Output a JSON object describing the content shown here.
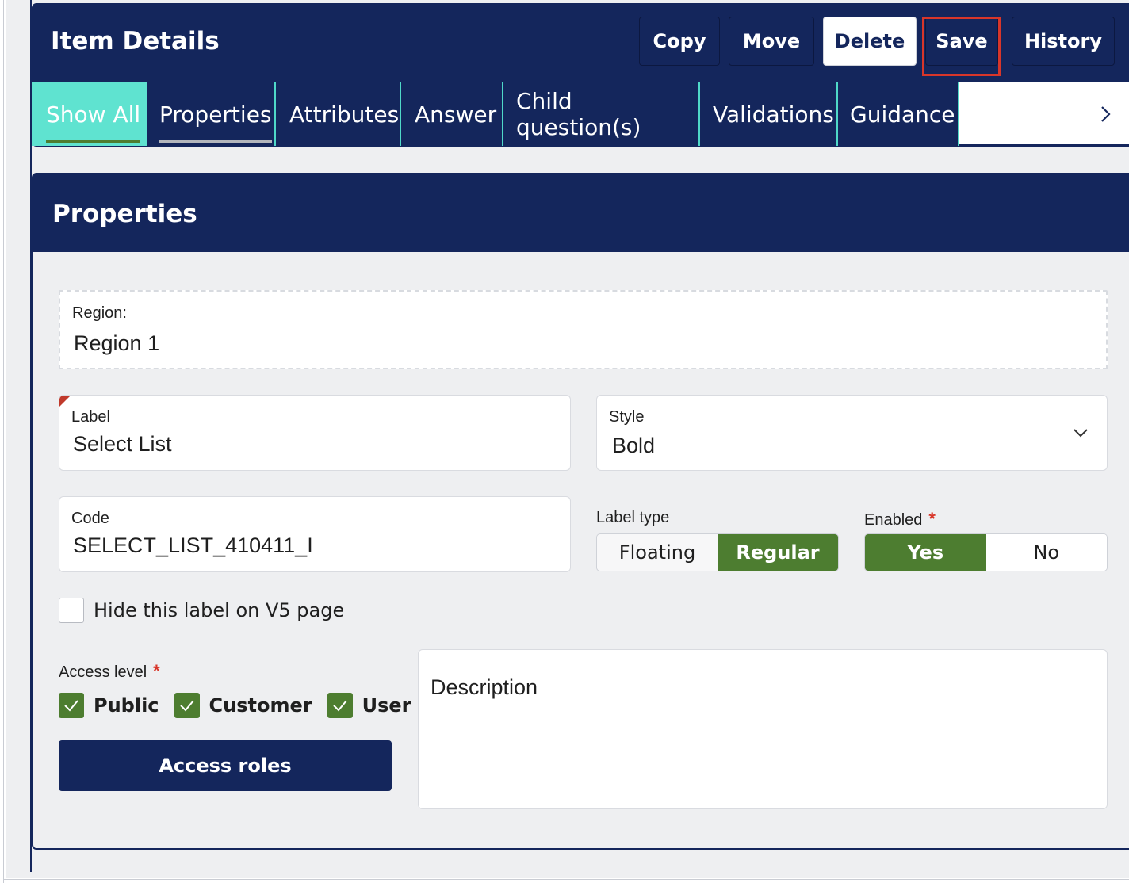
{
  "header": {
    "title": "Item Details",
    "buttons": {
      "copy": "Copy",
      "move": "Move",
      "delete": "Delete",
      "save": "Save",
      "history": "History"
    }
  },
  "tabs": [
    {
      "label": "Show All",
      "state": "active"
    },
    {
      "label": "Properties",
      "state": "selected"
    },
    {
      "label": "Attributes"
    },
    {
      "label": "Answer"
    },
    {
      "label": "Child question(s)"
    },
    {
      "label": "Validations"
    },
    {
      "label": "Guidance"
    }
  ],
  "tab_scroll_icon": "chevron-right-icon",
  "card": {
    "title": "Properties",
    "region": {
      "label": "Region:",
      "value": "Region 1"
    },
    "label_field": {
      "label": "Label",
      "value": "Select List"
    },
    "style_field": {
      "label": "Style",
      "value": "Bold",
      "icon": "chevron-down-icon"
    },
    "code_field": {
      "label": "Code",
      "value": "SELECT_LIST_410411_I"
    },
    "label_type": {
      "label": "Label type",
      "options": [
        "Floating",
        "Regular"
      ],
      "selected": "Regular"
    },
    "enabled": {
      "label": "Enabled",
      "required_mark": "*",
      "options": [
        "Yes",
        "No"
      ],
      "selected": "Yes"
    },
    "hide_label": {
      "label": "Hide this label on V5 page",
      "checked": false
    },
    "access_level": {
      "label": "Access level",
      "required_mark": "*",
      "options": [
        {
          "label": "Public",
          "checked": true
        },
        {
          "label": "Customer",
          "checked": true
        },
        {
          "label": "User",
          "checked": true
        }
      ]
    },
    "access_roles_button": "Access roles",
    "description": {
      "placeholder": "Description",
      "value": ""
    }
  },
  "colors": {
    "navy": "#14265c",
    "active_tab": "#5fe3d0",
    "green": "#4d7d30",
    "highlight": "#d8362a"
  }
}
